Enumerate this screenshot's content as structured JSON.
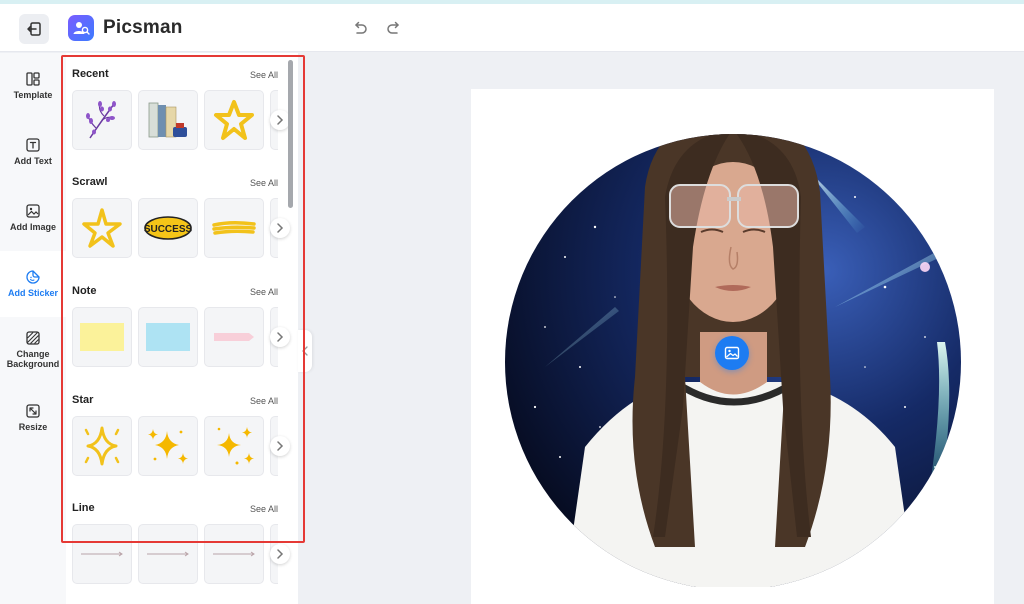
{
  "app": {
    "title": "Picsman"
  },
  "colors": {
    "accent": "#1d7cf2",
    "highlight": "#e53935",
    "nav_bg": "#f7f8fa"
  },
  "toolbar": {
    "icons": [
      "back-icon",
      "undo-icon",
      "redo-icon"
    ]
  },
  "nav": [
    {
      "label": "Template",
      "icon": "template-icon"
    },
    {
      "label": "Add Text",
      "icon": "text-icon"
    },
    {
      "label": "Add Image",
      "icon": "image-icon"
    },
    {
      "label": "Add Sticker",
      "icon": "sticker-icon",
      "active": true
    },
    {
      "label": "Change Background",
      "icon": "background-icon"
    },
    {
      "label": "Resize",
      "icon": "resize-icon"
    }
  ],
  "panel": {
    "see_all": "See All",
    "sections": [
      {
        "title": "Recent",
        "items": [
          "lavender-sprig",
          "books-and-ink",
          "yellow-star"
        ]
      },
      {
        "title": "Scrawl",
        "items": [
          "scrawl-star",
          "success-badge",
          "yellow-brush-stroke"
        ]
      },
      {
        "title": "Note",
        "items": [
          "yellow-note",
          "blue-note",
          "pink-arrow-note"
        ]
      },
      {
        "title": "Star",
        "items": [
          "sparkle-star",
          "twinkle-stars",
          "scattered-stars"
        ]
      },
      {
        "title": "Line",
        "items": [
          "arrow-line",
          "arrow-line",
          "arrow-line"
        ]
      }
    ],
    "sticker_text": {
      "success": "SUCCESS"
    }
  },
  "canvas": {
    "content": "portrait-photo"
  }
}
